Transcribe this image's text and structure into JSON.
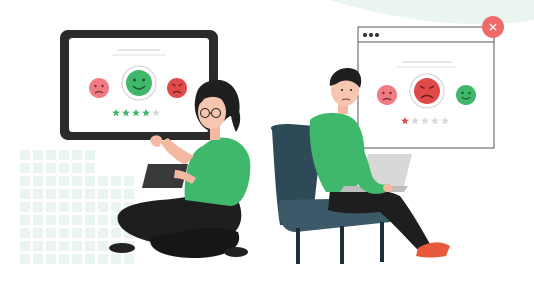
{
  "colors": {
    "accent_green": "#3fb86b",
    "negative_red": "#e04a4a",
    "face_pink": "#f07b82",
    "star_green": "#3fb86b",
    "star_red": "#e04a4a",
    "star_empty": "#d8d8d8",
    "chair": "#2f4a57",
    "tile": "#eaf5ef",
    "bg_blob": "#eaf5ef"
  },
  "left_feedback": {
    "faces": [
      "sad-face",
      "happy-face-selected",
      "angry-face"
    ],
    "rating": 4,
    "max_stars": 5
  },
  "right_feedback": {
    "window_dots": 3,
    "close_symbol": "✕",
    "faces": [
      "sad-face",
      "angry-face-selected",
      "happy-face"
    ],
    "rating": 1,
    "max_stars": 5
  }
}
